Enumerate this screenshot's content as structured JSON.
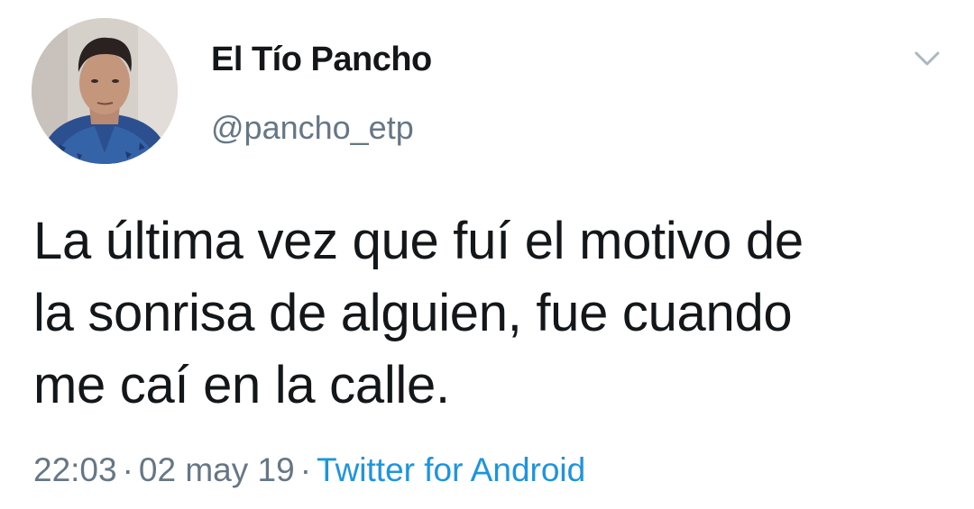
{
  "author": {
    "display_name": "El Tío Pancho",
    "handle": "@pancho_etp",
    "avatar_icon": "profile-photo"
  },
  "tweet": {
    "text_lines": [
      "La última vez que fuí el motivo de",
      "la sonrisa de alguien, fue cuando",
      "me caí en la calle."
    ]
  },
  "meta": {
    "time": "22:03",
    "separator": "·",
    "date": "02 may 19",
    "source": "Twitter for Android"
  },
  "menu": {
    "icon": "chevron-down-icon"
  },
  "colors": {
    "text": "#14171a",
    "secondary": "#657786",
    "link": "#1b95e0",
    "caret": "#aab8c2"
  }
}
